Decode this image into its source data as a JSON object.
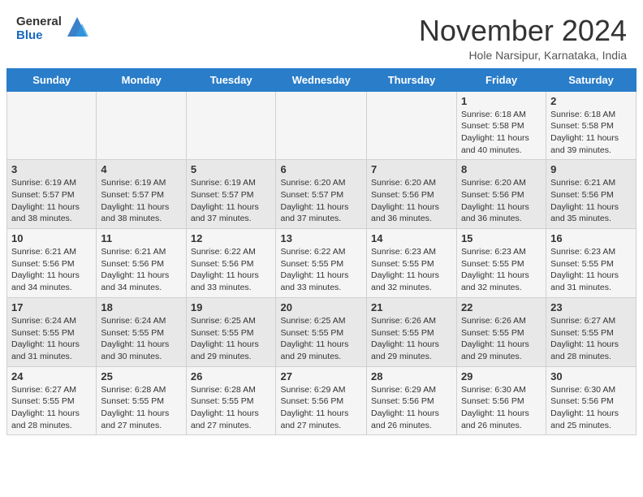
{
  "header": {
    "logo_line1": "General",
    "logo_line2": "Blue",
    "month_title": "November 2024",
    "location": "Hole Narsipur, Karnataka, India"
  },
  "calendar": {
    "days_of_week": [
      "Sunday",
      "Monday",
      "Tuesday",
      "Wednesday",
      "Thursday",
      "Friday",
      "Saturday"
    ],
    "weeks": [
      [
        {
          "day": "",
          "info": ""
        },
        {
          "day": "",
          "info": ""
        },
        {
          "day": "",
          "info": ""
        },
        {
          "day": "",
          "info": ""
        },
        {
          "day": "",
          "info": ""
        },
        {
          "day": "1",
          "info": "Sunrise: 6:18 AM\nSunset: 5:58 PM\nDaylight: 11 hours\nand 40 minutes."
        },
        {
          "day": "2",
          "info": "Sunrise: 6:18 AM\nSunset: 5:58 PM\nDaylight: 11 hours\nand 39 minutes."
        }
      ],
      [
        {
          "day": "3",
          "info": "Sunrise: 6:19 AM\nSunset: 5:57 PM\nDaylight: 11 hours\nand 38 minutes."
        },
        {
          "day": "4",
          "info": "Sunrise: 6:19 AM\nSunset: 5:57 PM\nDaylight: 11 hours\nand 38 minutes."
        },
        {
          "day": "5",
          "info": "Sunrise: 6:19 AM\nSunset: 5:57 PM\nDaylight: 11 hours\nand 37 minutes."
        },
        {
          "day": "6",
          "info": "Sunrise: 6:20 AM\nSunset: 5:57 PM\nDaylight: 11 hours\nand 37 minutes."
        },
        {
          "day": "7",
          "info": "Sunrise: 6:20 AM\nSunset: 5:56 PM\nDaylight: 11 hours\nand 36 minutes."
        },
        {
          "day": "8",
          "info": "Sunrise: 6:20 AM\nSunset: 5:56 PM\nDaylight: 11 hours\nand 36 minutes."
        },
        {
          "day": "9",
          "info": "Sunrise: 6:21 AM\nSunset: 5:56 PM\nDaylight: 11 hours\nand 35 minutes."
        }
      ],
      [
        {
          "day": "10",
          "info": "Sunrise: 6:21 AM\nSunset: 5:56 PM\nDaylight: 11 hours\nand 34 minutes."
        },
        {
          "day": "11",
          "info": "Sunrise: 6:21 AM\nSunset: 5:56 PM\nDaylight: 11 hours\nand 34 minutes."
        },
        {
          "day": "12",
          "info": "Sunrise: 6:22 AM\nSunset: 5:56 PM\nDaylight: 11 hours\nand 33 minutes."
        },
        {
          "day": "13",
          "info": "Sunrise: 6:22 AM\nSunset: 5:55 PM\nDaylight: 11 hours\nand 33 minutes."
        },
        {
          "day": "14",
          "info": "Sunrise: 6:23 AM\nSunset: 5:55 PM\nDaylight: 11 hours\nand 32 minutes."
        },
        {
          "day": "15",
          "info": "Sunrise: 6:23 AM\nSunset: 5:55 PM\nDaylight: 11 hours\nand 32 minutes."
        },
        {
          "day": "16",
          "info": "Sunrise: 6:23 AM\nSunset: 5:55 PM\nDaylight: 11 hours\nand 31 minutes."
        }
      ],
      [
        {
          "day": "17",
          "info": "Sunrise: 6:24 AM\nSunset: 5:55 PM\nDaylight: 11 hours\nand 31 minutes."
        },
        {
          "day": "18",
          "info": "Sunrise: 6:24 AM\nSunset: 5:55 PM\nDaylight: 11 hours\nand 30 minutes."
        },
        {
          "day": "19",
          "info": "Sunrise: 6:25 AM\nSunset: 5:55 PM\nDaylight: 11 hours\nand 29 minutes."
        },
        {
          "day": "20",
          "info": "Sunrise: 6:25 AM\nSunset: 5:55 PM\nDaylight: 11 hours\nand 29 minutes."
        },
        {
          "day": "21",
          "info": "Sunrise: 6:26 AM\nSunset: 5:55 PM\nDaylight: 11 hours\nand 29 minutes."
        },
        {
          "day": "22",
          "info": "Sunrise: 6:26 AM\nSunset: 5:55 PM\nDaylight: 11 hours\nand 29 minutes."
        },
        {
          "day": "23",
          "info": "Sunrise: 6:27 AM\nSunset: 5:55 PM\nDaylight: 11 hours\nand 28 minutes."
        }
      ],
      [
        {
          "day": "24",
          "info": "Sunrise: 6:27 AM\nSunset: 5:55 PM\nDaylight: 11 hours\nand 28 minutes."
        },
        {
          "day": "25",
          "info": "Sunrise: 6:28 AM\nSunset: 5:55 PM\nDaylight: 11 hours\nand 27 minutes."
        },
        {
          "day": "26",
          "info": "Sunrise: 6:28 AM\nSunset: 5:55 PM\nDaylight: 11 hours\nand 27 minutes."
        },
        {
          "day": "27",
          "info": "Sunrise: 6:29 AM\nSunset: 5:56 PM\nDaylight: 11 hours\nand 27 minutes."
        },
        {
          "day": "28",
          "info": "Sunrise: 6:29 AM\nSunset: 5:56 PM\nDaylight: 11 hours\nand 26 minutes."
        },
        {
          "day": "29",
          "info": "Sunrise: 6:30 AM\nSunset: 5:56 PM\nDaylight: 11 hours\nand 26 minutes."
        },
        {
          "day": "30",
          "info": "Sunrise: 6:30 AM\nSunset: 5:56 PM\nDaylight: 11 hours\nand 25 minutes."
        }
      ]
    ]
  }
}
